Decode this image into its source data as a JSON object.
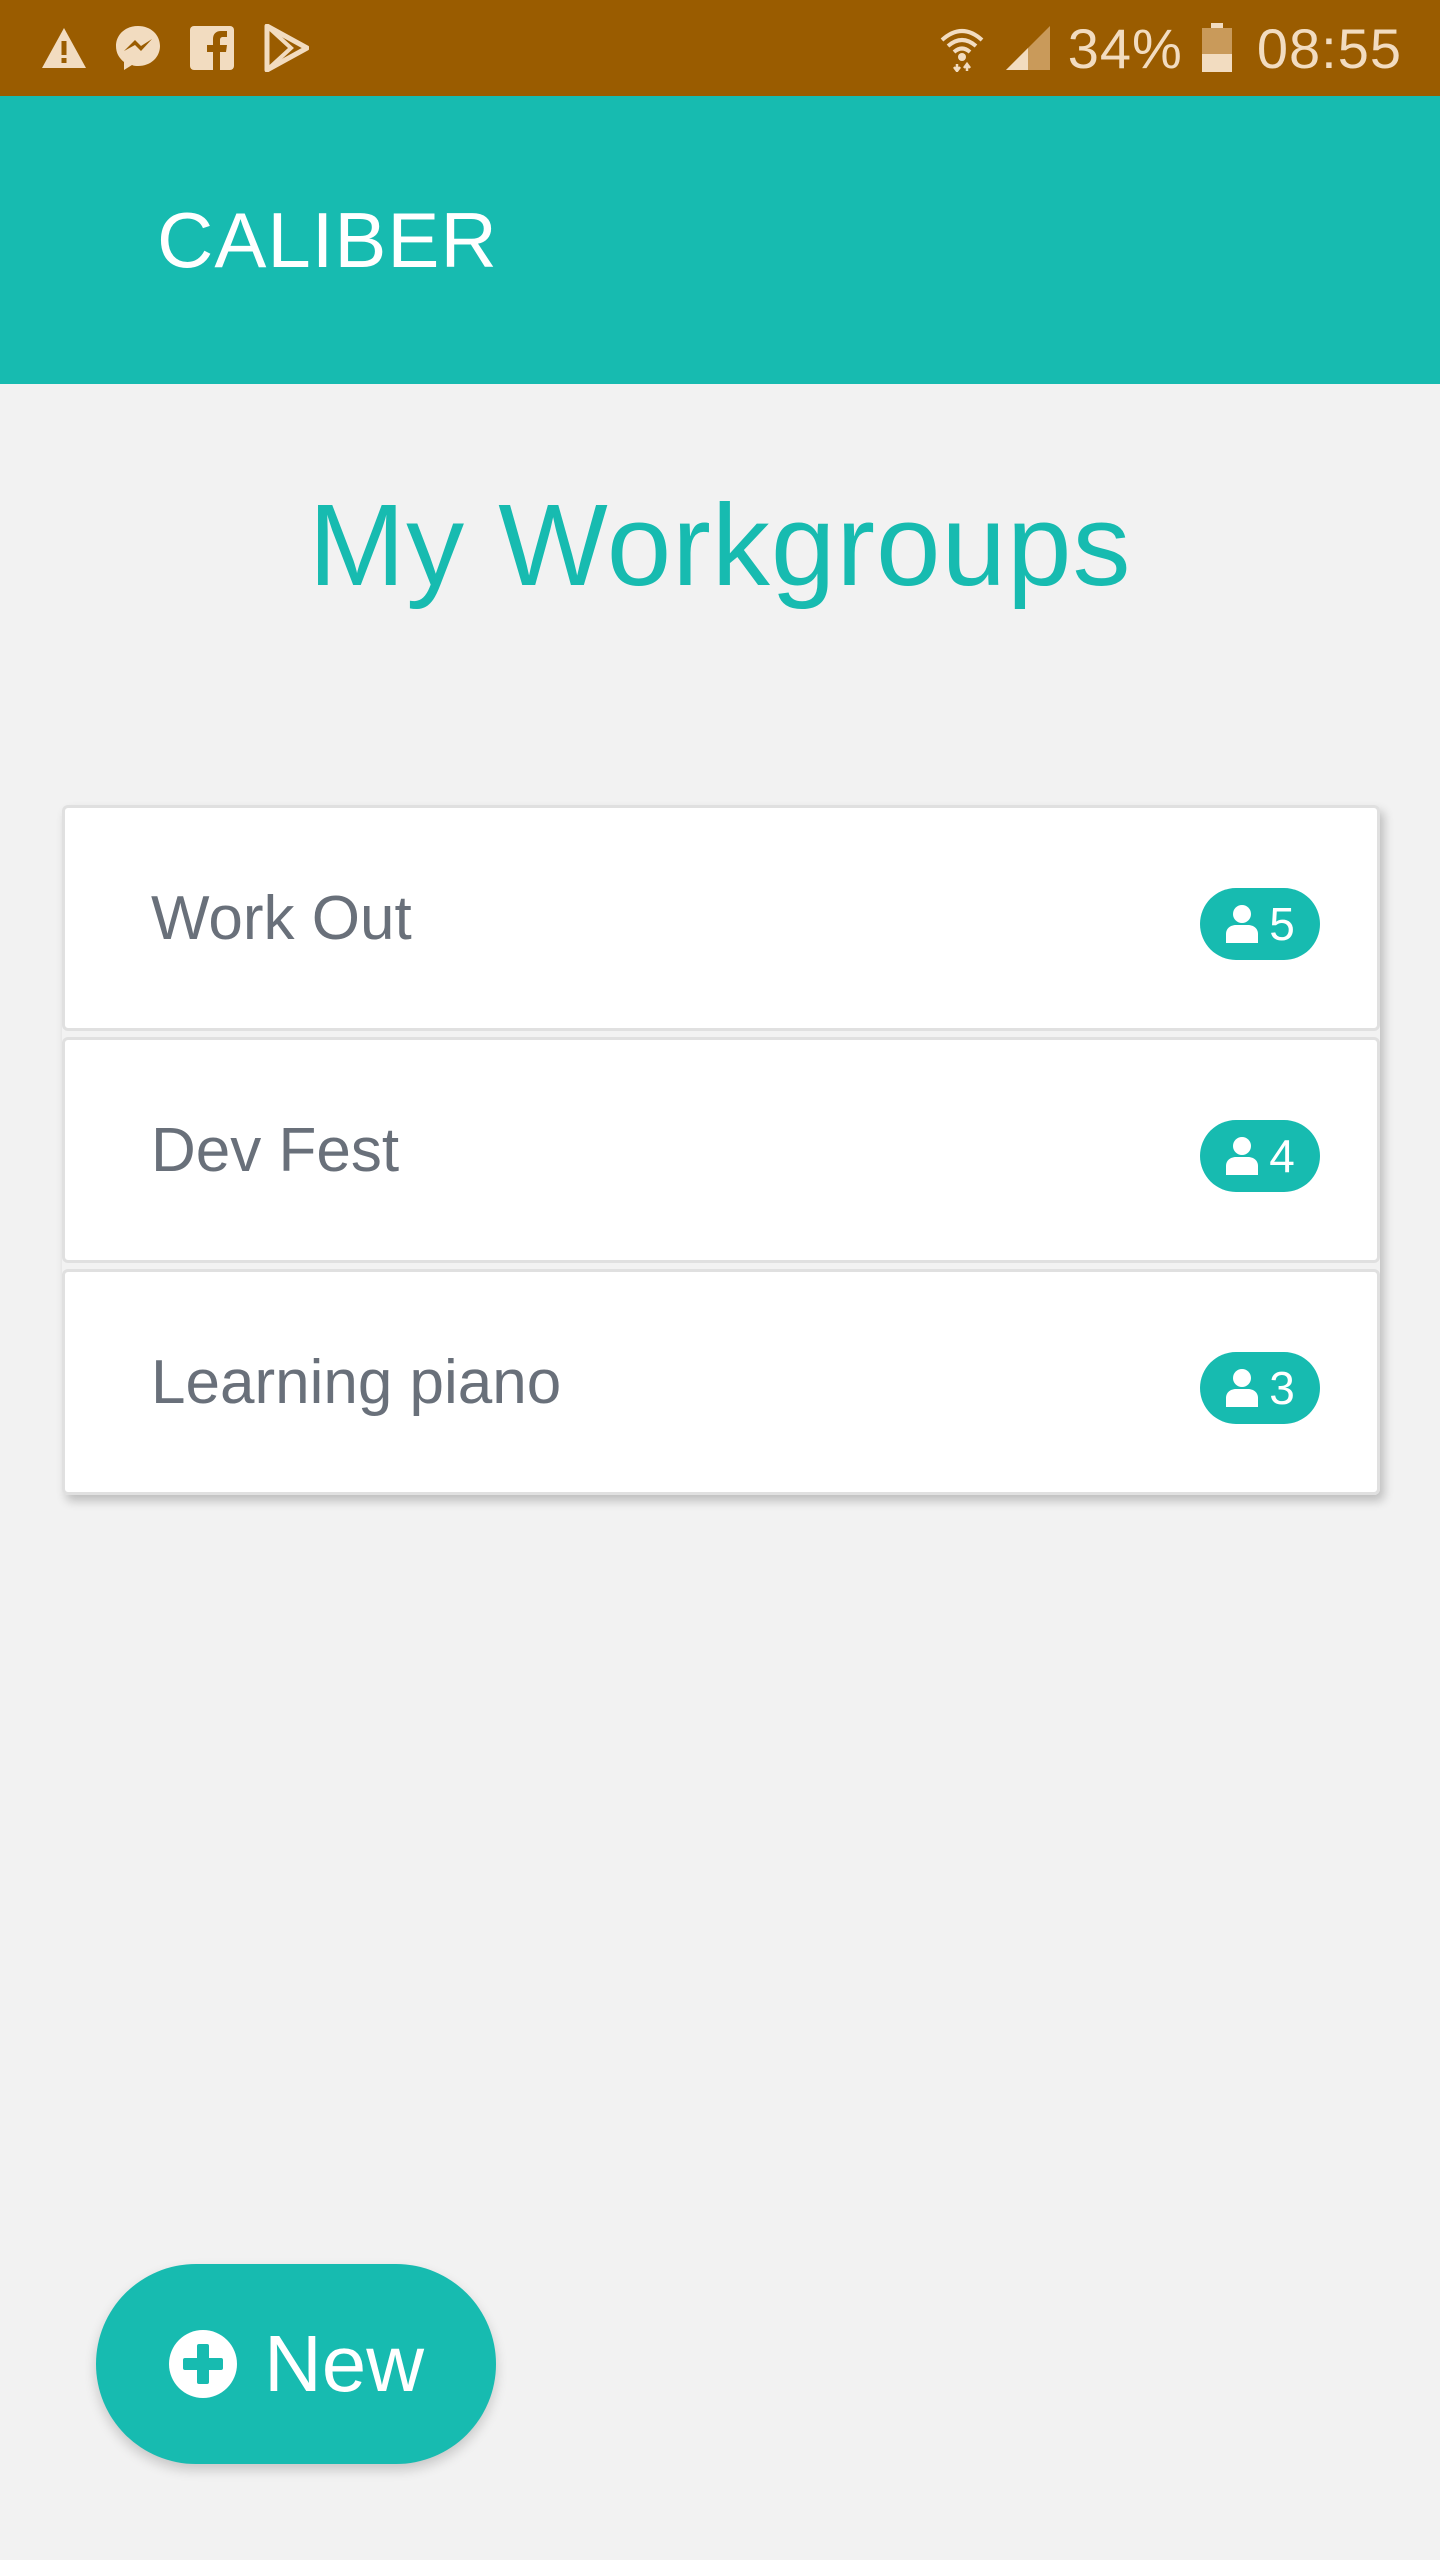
{
  "status_bar": {
    "battery": "34%",
    "time": "08:55",
    "icons_left": [
      "warning-icon",
      "messenger-icon",
      "facebook-icon",
      "play-store-icon"
    ],
    "icons_right": [
      "wifi-icon",
      "signal-icon",
      "battery-icon"
    ]
  },
  "app_bar": {
    "title": "CALIBER"
  },
  "page": {
    "title": "My Workgroups"
  },
  "workgroups": [
    {
      "name": "Work Out",
      "members": "5"
    },
    {
      "name": "Dev Fest",
      "members": "4"
    },
    {
      "name": "Learning piano",
      "members": "3"
    }
  ],
  "fab": {
    "label": "New"
  },
  "colors": {
    "status_bar": "#9a5c00",
    "accent": "#17bbb0",
    "background": "#f2f2f2",
    "text_muted": "#69707a"
  }
}
